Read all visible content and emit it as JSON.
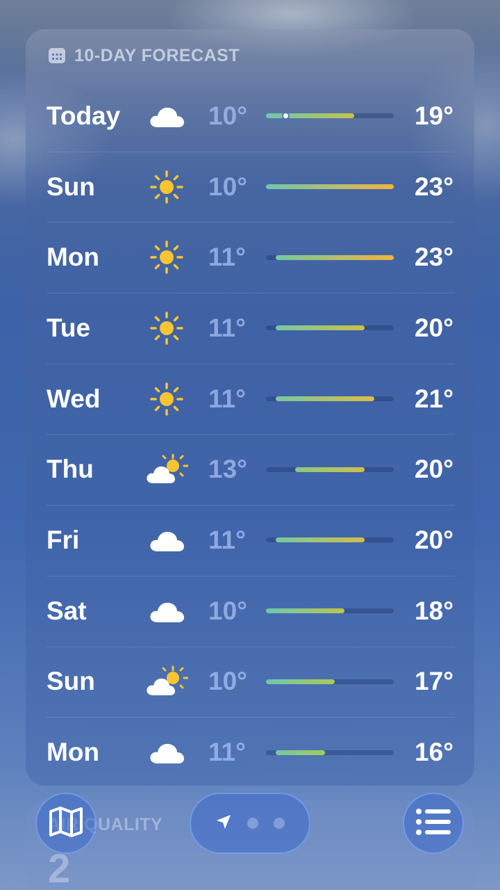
{
  "forecast": {
    "title": "10-DAY FORECAST",
    "scale_min": 10,
    "scale_max": 23,
    "current_temp": 12,
    "days": [
      {
        "day": "Today",
        "icon": "cloud-icon",
        "low": "10°",
        "high": "19°",
        "lo": 10,
        "hi": 19,
        "show_current": true
      },
      {
        "day": "Sun",
        "icon": "sun-icon",
        "low": "10°",
        "high": "23°",
        "lo": 10,
        "hi": 23
      },
      {
        "day": "Mon",
        "icon": "sun-icon",
        "low": "11°",
        "high": "23°",
        "lo": 11,
        "hi": 23
      },
      {
        "day": "Tue",
        "icon": "sun-icon",
        "low": "11°",
        "high": "20°",
        "lo": 11,
        "hi": 20
      },
      {
        "day": "Wed",
        "icon": "sun-icon",
        "low": "11°",
        "high": "21°",
        "lo": 11,
        "hi": 21
      },
      {
        "day": "Thu",
        "icon": "partly-cloudy-icon",
        "low": "13°",
        "high": "20°",
        "lo": 13,
        "hi": 20
      },
      {
        "day": "Fri",
        "icon": "cloud-icon",
        "low": "11°",
        "high": "20°",
        "lo": 11,
        "hi": 20
      },
      {
        "day": "Sat",
        "icon": "cloud-icon",
        "low": "10°",
        "high": "18°",
        "lo": 10,
        "hi": 18
      },
      {
        "day": "Sun",
        "icon": "partly-cloudy-icon",
        "low": "10°",
        "high": "17°",
        "lo": 10,
        "hi": 17
      },
      {
        "day": "Mon",
        "icon": "cloud-icon",
        "low": "11°",
        "high": "16°",
        "lo": 11,
        "hi": 16
      }
    ]
  },
  "air_quality": {
    "label": "AIR QUALITY",
    "value": "2"
  },
  "toolbar": {
    "map_icon": "map-icon",
    "location_icon": "location-arrow-icon",
    "list_icon": "list-icon",
    "page_count": 3
  },
  "colors": {
    "cool": "#6cc7b0",
    "mild": "#a8cc55",
    "warm": "#f2b53a",
    "sun": "#f7c531"
  }
}
